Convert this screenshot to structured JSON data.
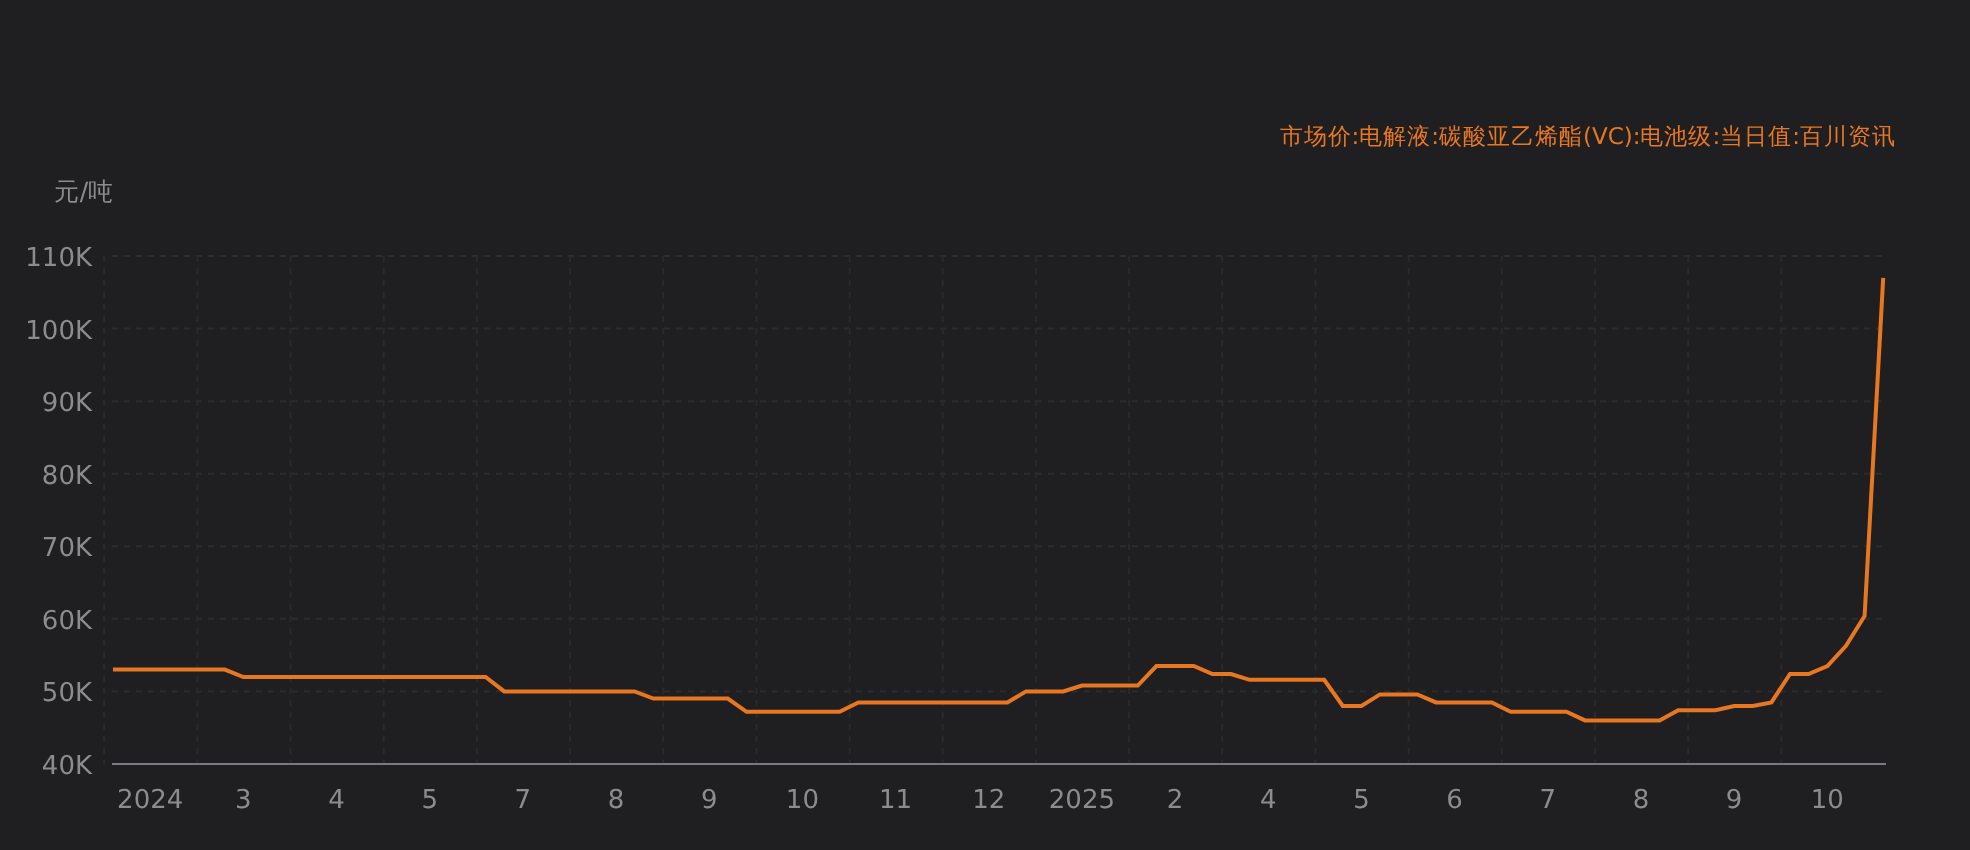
{
  "chart_data": {
    "type": "line",
    "grid": true,
    "title": "市场价:电解液:碳酸亚乙烯酯(VC):电池级:当日值:百川资讯",
    "ylabel": "元/吨",
    "ylim": [
      40000,
      110000
    ],
    "yticks": [
      {
        "value": 40000,
        "label": "40K"
      },
      {
        "value": 50000,
        "label": "50K"
      },
      {
        "value": 60000,
        "label": "60K"
      },
      {
        "value": 70000,
        "label": "70K"
      },
      {
        "value": 80000,
        "label": "80K"
      },
      {
        "value": 90000,
        "label": "90K"
      },
      {
        "value": 100000,
        "label": "100K"
      },
      {
        "value": 110000,
        "label": "110K"
      }
    ],
    "categories": [
      null,
      null,
      "2024",
      null,
      null,
      null,
      null,
      "3",
      null,
      null,
      null,
      null,
      "4",
      null,
      null,
      null,
      null,
      "5",
      null,
      null,
      null,
      null,
      "7",
      null,
      null,
      null,
      null,
      "8",
      null,
      null,
      null,
      null,
      "9",
      null,
      null,
      null,
      null,
      "10",
      null,
      null,
      null,
      null,
      "11",
      null,
      null,
      null,
      null,
      "12",
      null,
      null,
      null,
      null,
      "2025",
      null,
      null,
      null,
      null,
      "2",
      null,
      null,
      null,
      null,
      "4",
      null,
      null,
      null,
      null,
      "5",
      null,
      null,
      null,
      null,
      "6",
      null,
      null,
      null,
      null,
      "7",
      null,
      null,
      null,
      null,
      "8",
      null,
      null,
      null,
      null,
      "9",
      null,
      null,
      null,
      null,
      "10",
      null,
      null,
      null
    ],
    "series": [
      {
        "color": "#e87722",
        "values": [
          53000,
          53000,
          53000,
          53000,
          53000,
          53000,
          53000,
          52000,
          52000,
          52000,
          52000,
          52000,
          52000,
          52000,
          52000,
          52000,
          52000,
          52000,
          52000,
          52000,
          52000,
          50000,
          50000,
          50000,
          50000,
          50000,
          50000,
          50000,
          50000,
          49000,
          49000,
          49000,
          49000,
          49000,
          47200,
          47200,
          47200,
          47200,
          47200,
          47200,
          48500,
          48500,
          48500,
          48500,
          48500,
          48500,
          48500,
          48500,
          48500,
          50000,
          50000,
          50000,
          50800,
          50800,
          50800,
          50800,
          53500,
          53500,
          53500,
          52400,
          52400,
          51600,
          51600,
          51600,
          51600,
          51600,
          48000,
          48000,
          49600,
          49600,
          49600,
          48500,
          48500,
          48500,
          48500,
          47200,
          47200,
          47200,
          47200,
          46000,
          46000,
          46000,
          46000,
          46000,
          47400,
          47400,
          47400,
          48000,
          48000,
          48500,
          52400,
          52400,
          53500,
          56300,
          60400,
          107000
        ]
      }
    ]
  }
}
